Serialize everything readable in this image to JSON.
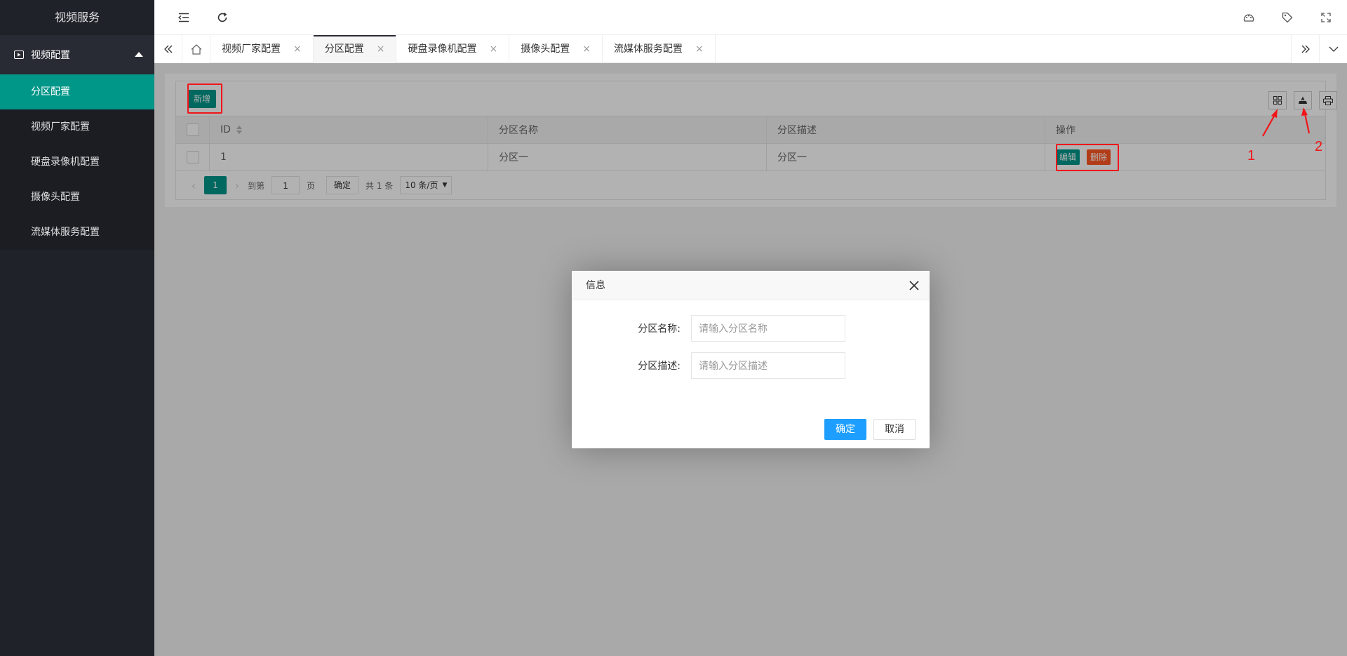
{
  "sidebar": {
    "title": "视频服务",
    "group": {
      "icon": "video-icon",
      "label": "视频配置"
    },
    "items": [
      {
        "label": "分区配置",
        "active": true
      },
      {
        "label": "视频厂家配置",
        "active": false
      },
      {
        "label": "硬盘录像机配置",
        "active": false
      },
      {
        "label": "摄像头配置",
        "active": false
      },
      {
        "label": "流媒体服务配置",
        "active": false
      }
    ]
  },
  "header": {
    "left_icons": [
      "menu-fold-icon",
      "refresh-icon"
    ],
    "right_icons": [
      "theme-icon",
      "tag-icon",
      "fullscreen-icon"
    ]
  },
  "tabs": {
    "items": [
      {
        "label": "视频厂家配置",
        "active": false
      },
      {
        "label": "分区配置",
        "active": true
      },
      {
        "label": "硬盘录像机配置",
        "active": false
      },
      {
        "label": "摄像头配置",
        "active": false
      },
      {
        "label": "流媒体服务配置",
        "active": false
      }
    ],
    "close_glyph": "×"
  },
  "table": {
    "add_label": "新增",
    "tool_icons": [
      "columns-icon",
      "export-icon",
      "print-icon"
    ],
    "columns": [
      "ID",
      "分区名称",
      "分区描述",
      "操作"
    ],
    "rows": [
      {
        "id": "1",
        "name": "分区一",
        "desc": "分区一"
      }
    ],
    "edit_label": "编辑",
    "delete_label": "删除"
  },
  "pager": {
    "current": "1",
    "goto_label": "到第",
    "goto_value": "1",
    "page_label": "页",
    "confirm_label": "确定",
    "total_label": "共 1 条",
    "size_label": "10 条/页"
  },
  "dialog": {
    "title": "信息",
    "fields": [
      {
        "label": "分区名称:",
        "placeholder": "请输入分区名称"
      },
      {
        "label": "分区描述:",
        "placeholder": "请输入分区描述"
      }
    ],
    "ok_label": "确定",
    "cancel_label": "取消"
  },
  "annotations": {
    "num1": "1",
    "num2": "2",
    "color": "#f0161a"
  },
  "colors": {
    "accent": "#009688",
    "danger": "#ff5722",
    "primary": "#1e9fff",
    "sidebar_bg": "#20222a"
  }
}
